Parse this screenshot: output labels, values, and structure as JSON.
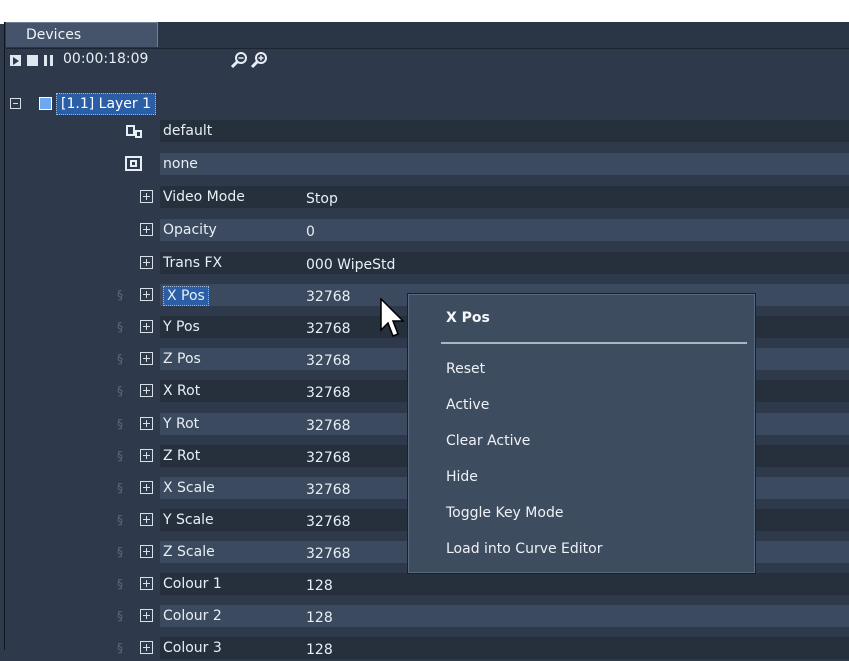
{
  "tab": {
    "label": "Devices"
  },
  "transport": {
    "timecode": "00:00:18:09"
  },
  "layer": {
    "label": "[1.1] Layer 1"
  },
  "rows": [
    {
      "name": "default",
      "value": ""
    },
    {
      "name": "none",
      "value": ""
    },
    {
      "name": "Video Mode",
      "value": "Stop"
    },
    {
      "name": "Opacity",
      "value": "0"
    },
    {
      "name": "Trans FX",
      "value": "000 WipeStd"
    },
    {
      "name": "X Pos",
      "value": "32768"
    },
    {
      "name": "Y Pos",
      "value": "32768"
    },
    {
      "name": "Z Pos",
      "value": "32768"
    },
    {
      "name": "X Rot",
      "value": "32768"
    },
    {
      "name": "Y Rot",
      "value": "32768"
    },
    {
      "name": "Z Rot",
      "value": "32768"
    },
    {
      "name": "X Scale",
      "value": "32768"
    },
    {
      "name": "Y Scale",
      "value": "32768"
    },
    {
      "name": "Z Scale",
      "value": "32768"
    },
    {
      "name": "Colour 1",
      "value": "128"
    },
    {
      "name": "Colour 2",
      "value": "128"
    },
    {
      "name": "Colour 3",
      "value": "128"
    }
  ],
  "context_menu": {
    "title": "X Pos",
    "items": [
      "Reset",
      "Active",
      "Clear Active",
      "Hide",
      "Toggle Key Mode",
      "Load into Curve Editor"
    ]
  }
}
